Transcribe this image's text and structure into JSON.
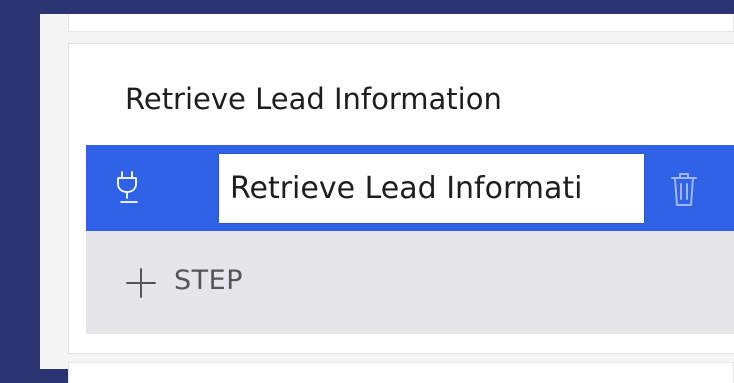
{
  "stage": {
    "title": "Retrieve Lead Information"
  },
  "step": {
    "name_value": "Retrieve Lead Informati",
    "icon": "plug-icon",
    "delete_icon": "trash-icon"
  },
  "add_step": {
    "label": "STEP",
    "icon": "plus-icon"
  },
  "colors": {
    "background": "#2b3472",
    "workspace": "#f4f4f4",
    "selected_row": "#2f62e6",
    "add_step_row": "#e6e6ea",
    "text": "#1e1e1e"
  }
}
